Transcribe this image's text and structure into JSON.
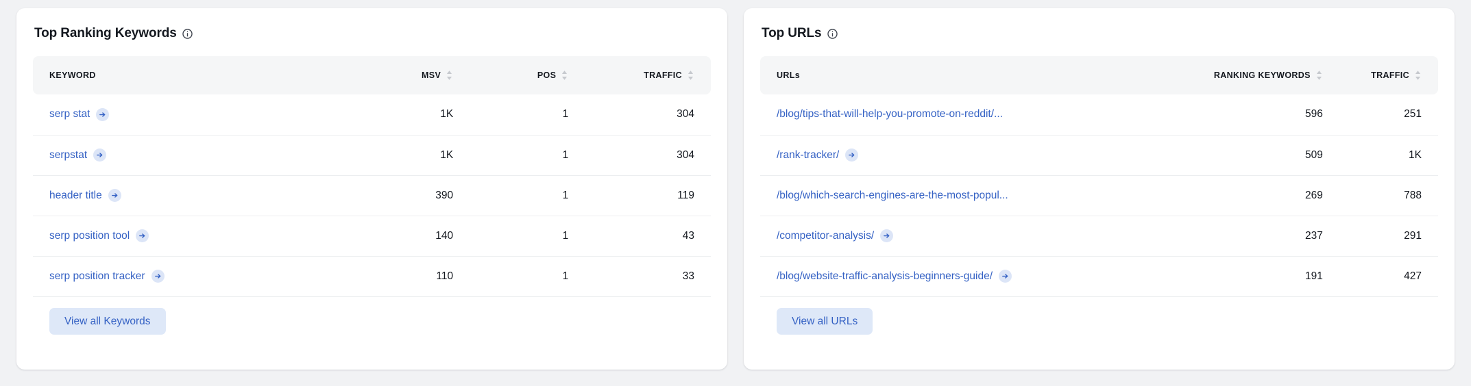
{
  "theme": {
    "page_background": "#f1f2f4",
    "card_background": "#ffffff",
    "link_color": "#3461c4",
    "button_background": "#dee8f8",
    "header_row_background": "#f5f6f7",
    "text_color": "#14181f",
    "arrow_badge_background": "#dce5f7"
  },
  "cards": {
    "keywords": {
      "title": "Top Ranking Keywords",
      "info_icon": "info-circle-icon",
      "columns": [
        {
          "label": "KEYWORD",
          "align": "left",
          "sortable": false
        },
        {
          "label": "MSV",
          "align": "right",
          "sortable": true
        },
        {
          "label": "POS",
          "align": "right",
          "sortable": true
        },
        {
          "label": "TRAFFIC",
          "align": "right",
          "sortable": true
        }
      ],
      "rows": [
        {
          "keyword": "serp stat",
          "msv": "1K",
          "pos": "1",
          "traffic": "304",
          "arrow": true
        },
        {
          "keyword": "serpstat",
          "msv": "1K",
          "pos": "1",
          "traffic": "304",
          "arrow": true
        },
        {
          "keyword": "header title",
          "msv": "390",
          "pos": "1",
          "traffic": "119",
          "arrow": true
        },
        {
          "keyword": "serp position tool",
          "msv": "140",
          "pos": "1",
          "traffic": "43",
          "arrow": true
        },
        {
          "keyword": "serp position tracker",
          "msv": "110",
          "pos": "1",
          "traffic": "33",
          "arrow": true
        }
      ],
      "view_all_label": "View all Keywords"
    },
    "urls": {
      "title": "Top URLs",
      "info_icon": "info-circle-icon",
      "columns": [
        {
          "label": "URLs",
          "align": "left",
          "sortable": false
        },
        {
          "label": "RANKING KEYWORDS",
          "align": "right",
          "sortable": true
        },
        {
          "label": "TRAFFIC",
          "align": "right",
          "sortable": true
        }
      ],
      "rows": [
        {
          "url": "/blog/tips-that-will-help-you-promote-on-reddit/...",
          "ranking_keywords": "596",
          "traffic": "251",
          "arrow": false
        },
        {
          "url": "/rank-tracker/",
          "ranking_keywords": "509",
          "traffic": "1K",
          "arrow": true
        },
        {
          "url": "/blog/which-search-engines-are-the-most-popul...",
          "ranking_keywords": "269",
          "traffic": "788",
          "arrow": false
        },
        {
          "url": "/competitor-analysis/",
          "ranking_keywords": "237",
          "traffic": "291",
          "arrow": true
        },
        {
          "url": "/blog/website-traffic-analysis-beginners-guide/",
          "ranking_keywords": "191",
          "traffic": "427",
          "arrow": true
        }
      ],
      "view_all_label": "View all URLs"
    }
  }
}
